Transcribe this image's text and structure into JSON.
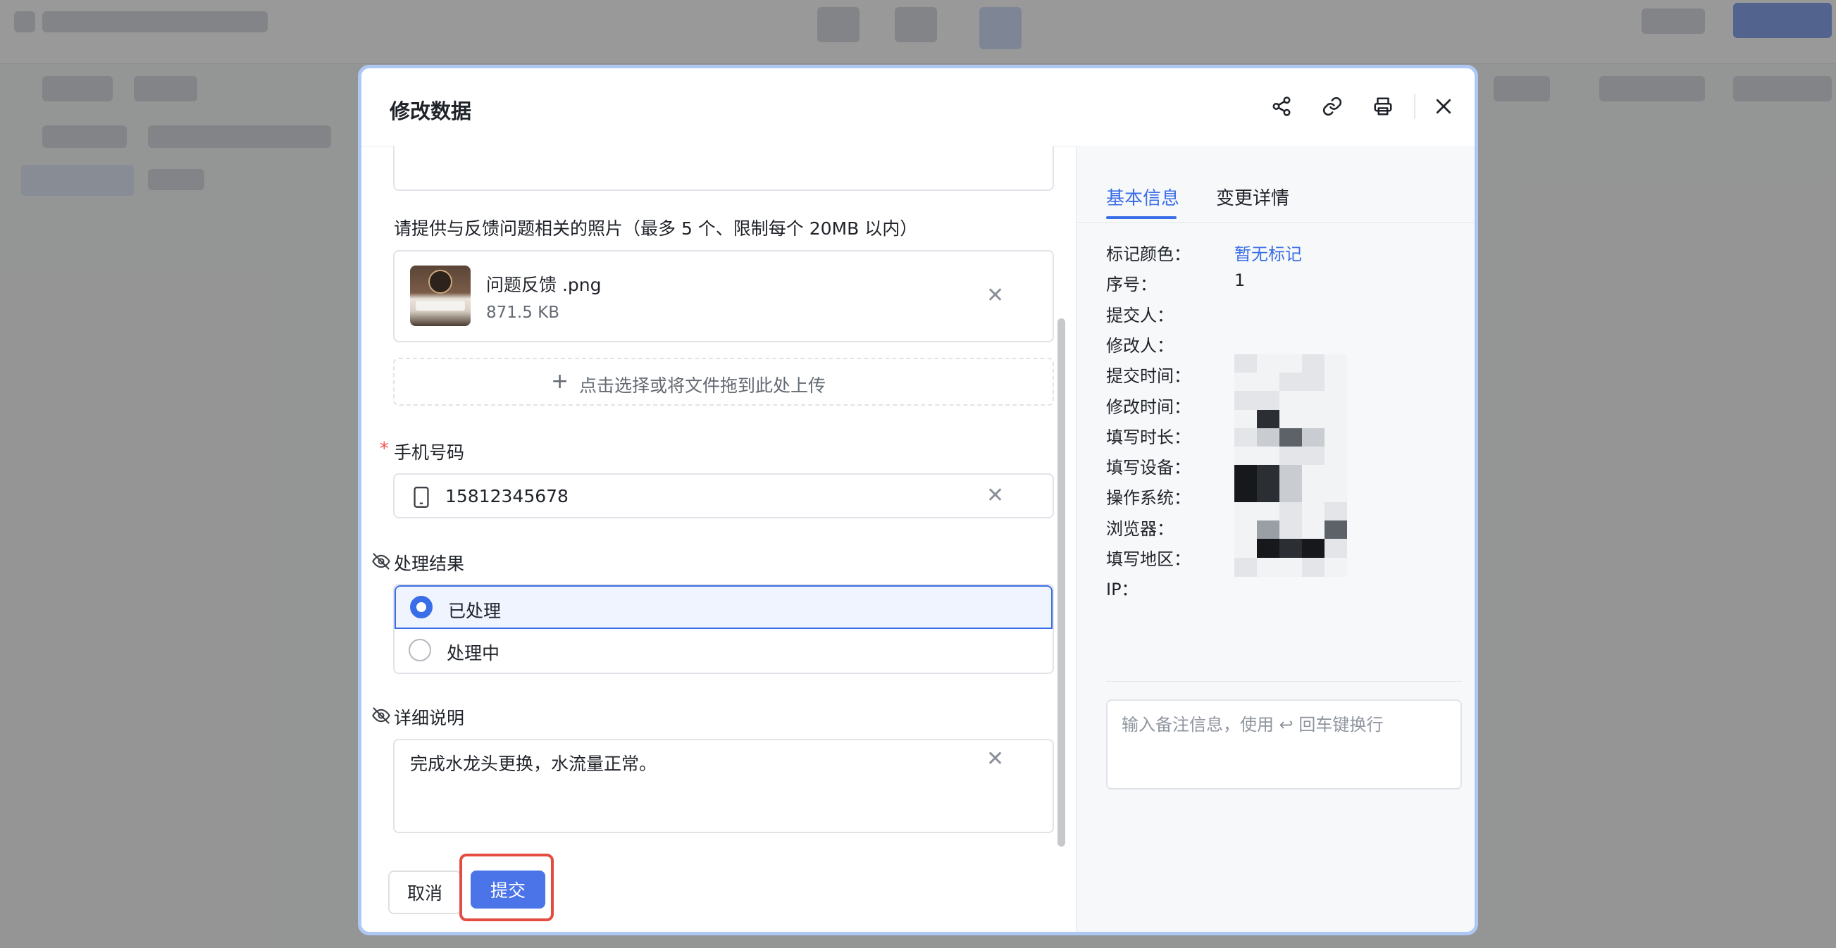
{
  "modal": {
    "title": "修改数据"
  },
  "form": {
    "photo_label": "请提供与反馈问题相关的照片（最多 5 个、限制每个 20MB 以内）",
    "file": {
      "name": "问题反馈 .png",
      "size": "871.5 KB"
    },
    "upload_hint": "点击选择或将文件拖到此处上传",
    "phone": {
      "label": "手机号码",
      "value": "15812345678"
    },
    "result": {
      "label": "处理结果",
      "options": [
        "已处理",
        "处理中"
      ],
      "selected": "已处理"
    },
    "detail": {
      "label": "详细说明",
      "value": "完成水龙头更换，水流量正常。"
    }
  },
  "footer": {
    "cancel": "取消",
    "submit": "提交"
  },
  "sidepanel": {
    "tabs": [
      "基本信息",
      "变更详情"
    ],
    "fields": [
      {
        "key": "标记颜色：",
        "value": "暂无标记"
      },
      {
        "key": "序号：",
        "value": "1"
      },
      {
        "key": "提交人：",
        "value": ""
      },
      {
        "key": "修改人：",
        "value": ""
      },
      {
        "key": "提交时间：",
        "value": ""
      },
      {
        "key": "修改时间：",
        "value": ""
      },
      {
        "key": "填写时长：",
        "value": ""
      },
      {
        "key": "填写设备：",
        "value": ""
      },
      {
        "key": "操作系统：",
        "value": ""
      },
      {
        "key": "浏览器：",
        "value": ""
      },
      {
        "key": "填写地区：",
        "value": ""
      },
      {
        "key": "IP：",
        "value": ""
      }
    ],
    "note_placeholder": "输入备注信息，使用 ↩ 回车键换行"
  },
  "colors": {
    "accent": "#3a6ee8",
    "required": "#f54a45",
    "highlight": "#e34d41"
  }
}
